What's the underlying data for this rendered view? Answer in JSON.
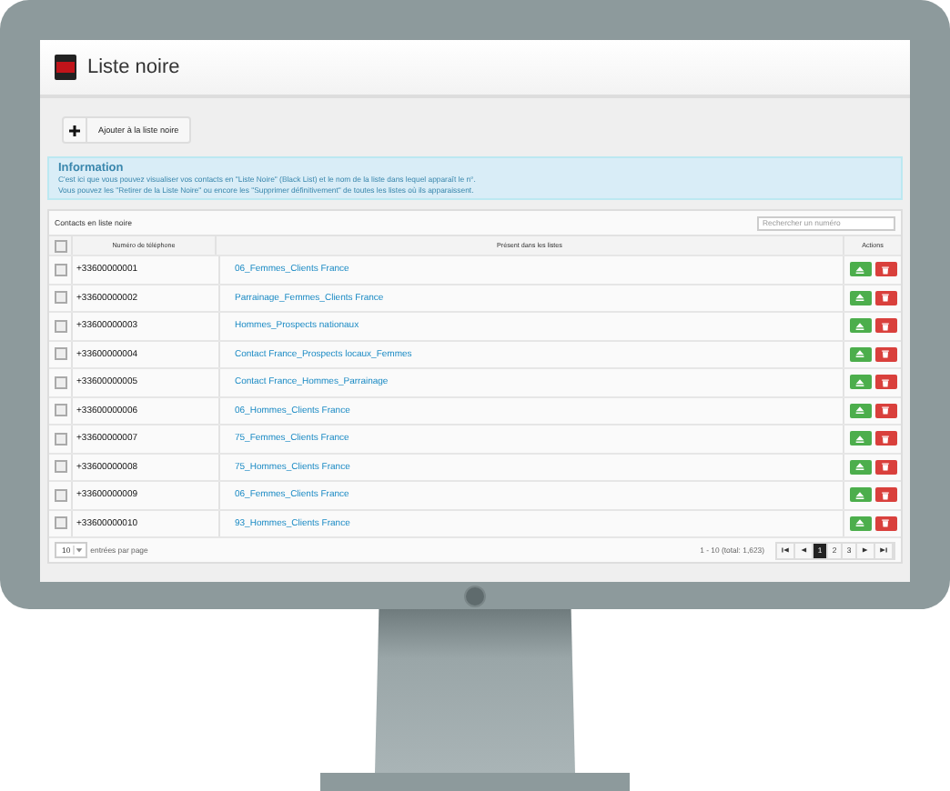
{
  "header": {
    "title": "Liste noire"
  },
  "add_button": {
    "label": "Ajouter à la liste noire"
  },
  "info": {
    "title": "Information",
    "lines": [
      "C'est ici que vous pouvez visualiser vos contacts en \"Liste Noire\" (Black List) et le nom de la liste dans lequel apparaît le n°.",
      "Vous pouvez les \"Retirer de la Liste Noire\" ou encore les \"Supprimer définitivement\" de toutes les listes où ils apparaissent."
    ]
  },
  "table": {
    "caption": "Contacts en liste noire",
    "search": {
      "placeholder": "Rechercher un numéro"
    },
    "select_all": {
      "checked": false
    },
    "columns": [
      "Numéro de téléphone",
      "Présent dans les listes",
      "Actions"
    ],
    "rows": [
      {
        "checked": false,
        "phone": "+33600000001",
        "list": "06_Femmes_Clients France"
      },
      {
        "checked": false,
        "phone": "+33600000002",
        "list": "Parrainage_Femmes_Clients France"
      },
      {
        "checked": false,
        "phone": "+33600000003",
        "list": "Hommes_Prospects nationaux"
      },
      {
        "checked": false,
        "phone": "+33600000004",
        "list": "Contact France_Prospects locaux_Femmes"
      },
      {
        "checked": false,
        "phone": "+33600000005",
        "list": "Contact France_Hommes_Parrainage"
      },
      {
        "checked": false,
        "phone": "+33600000006",
        "list": "06_Hommes_Clients France"
      },
      {
        "checked": false,
        "phone": "+33600000007",
        "list": "75_Femmes_Clients France"
      },
      {
        "checked": false,
        "phone": "+33600000008",
        "list": "75_Hommes_Clients France"
      },
      {
        "checked": false,
        "phone": "+33600000009",
        "list": "06_Femmes_Clients France"
      },
      {
        "checked": false,
        "phone": "+33600000010",
        "list": "93_Hommes_Clients France"
      }
    ]
  },
  "footer": {
    "page_size": "10",
    "page_size_label": "entrées par page",
    "summary": "1 - 10 (total: 1,623)",
    "pages": [
      {
        "label": "1",
        "selected": true
      },
      {
        "label": "2",
        "selected": false
      },
      {
        "label": "3",
        "selected": false
      }
    ]
  }
}
